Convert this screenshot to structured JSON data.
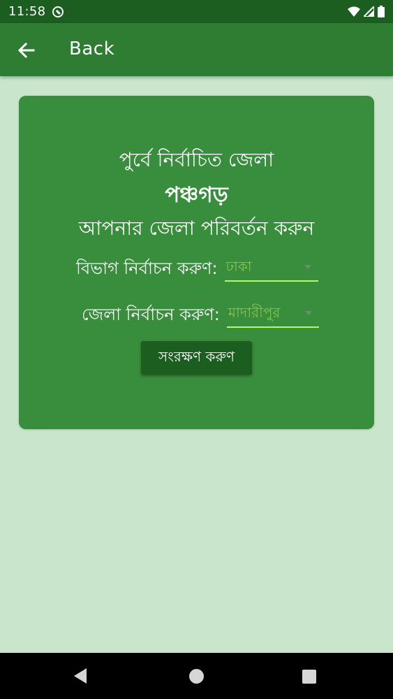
{
  "status_bar": {
    "time": "11:58",
    "icons": [
      "notification-blocked-icon",
      "wifi-icon",
      "signal-icon",
      "battery-icon"
    ]
  },
  "app_bar": {
    "back_icon": "arrow-back-icon",
    "title": "Back"
  },
  "card": {
    "previous_label": "পুর্বে নির্বাচিত জেলা",
    "current_district": "পঞ্চগড়",
    "change_label": "আপনার জেলা পরিবর্তন করুন",
    "division": {
      "label": "বিভাগ নির্বাচন করুণ:",
      "selected": "ঢাকা"
    },
    "district": {
      "label": "জেলা নির্বাচন করুণ:",
      "selected": "মাদারীপুর"
    },
    "save_label": "সংরক্ষণ করুণ"
  },
  "nav_bar": {
    "icons": [
      "nav-back-icon",
      "nav-home-icon",
      "nav-recents-icon"
    ]
  },
  "colors": {
    "status_bar": "#1b5e20",
    "app_bar": "#2e7d32",
    "card": "#388e3c",
    "background": "#c9e6cc",
    "dropdown_text": "#8bc34a",
    "dropdown_underline": "#b2ff59",
    "button": "#1b5e20"
  }
}
